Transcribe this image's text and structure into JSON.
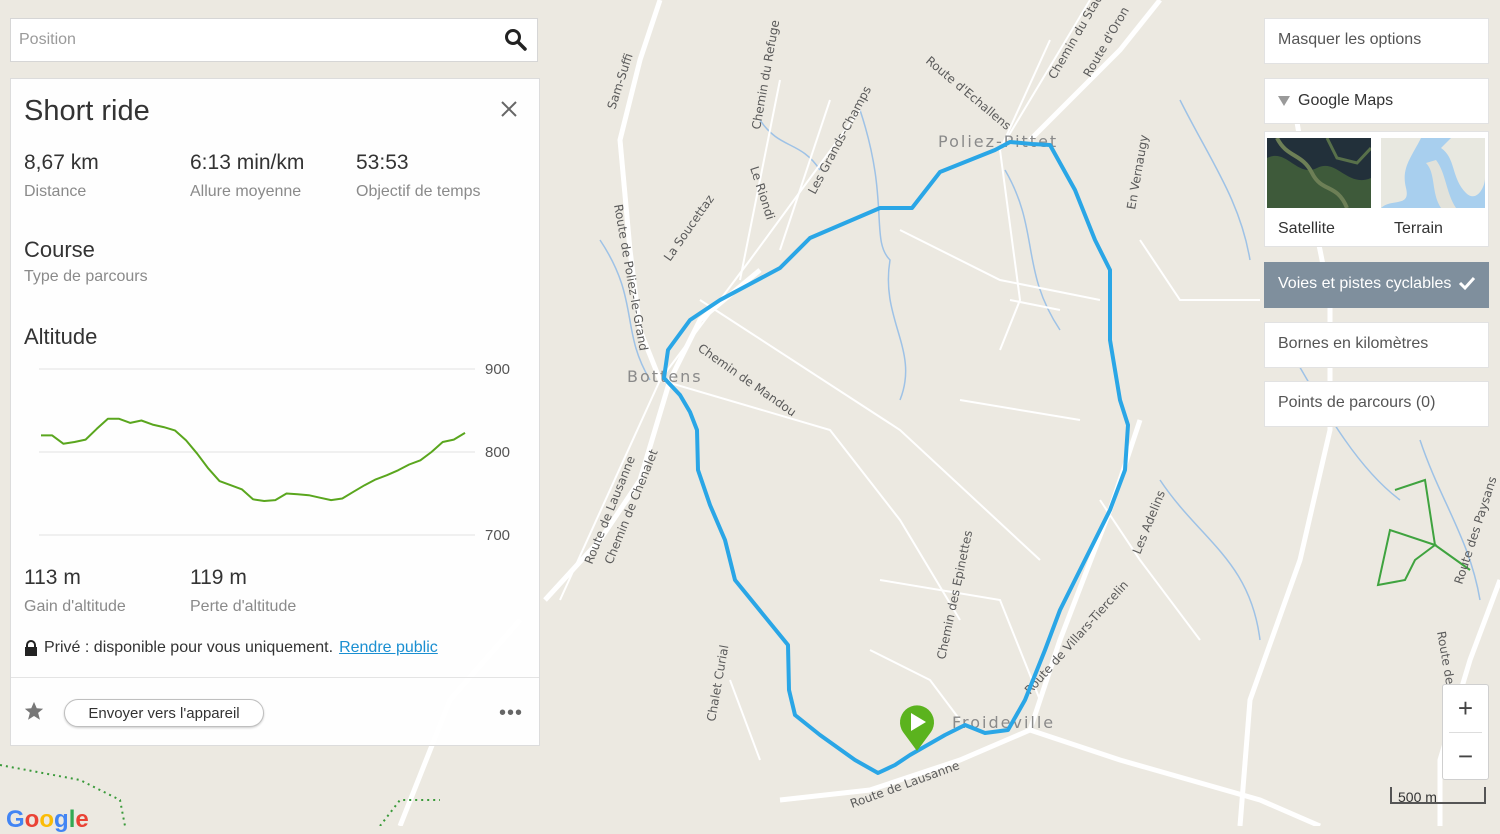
{
  "search": {
    "placeholder": "Position"
  },
  "panel": {
    "title": "Short ride",
    "stats": [
      {
        "value": "8,67 km",
        "label": "Distance"
      },
      {
        "value": "6:13 min/km",
        "label": "Allure moyenne"
      },
      {
        "value": "53:53",
        "label": "Objectif de temps"
      }
    ],
    "route_type": {
      "value": "Course",
      "label": "Type de parcours"
    },
    "altitude_title": "Altitude",
    "elevation": [
      {
        "value": "113 m",
        "label": "Gain d'altitude"
      },
      {
        "value": "119 m",
        "label": "Perte d'altitude"
      }
    ],
    "privacy_text": "Privé : disponible pour vous uniquement.",
    "privacy_link": "Rendre public",
    "send_button": "Envoyer vers l'appareil",
    "more_label": "•••"
  },
  "chart_data": {
    "type": "line",
    "ylabel": "",
    "ylim": [
      700,
      900
    ],
    "yticks": [
      900,
      800,
      700
    ],
    "series": [
      {
        "values": [
          820,
          820,
          810,
          812,
          815,
          828,
          840,
          840,
          835,
          838,
          833,
          830,
          826,
          814,
          798,
          780,
          765,
          760,
          755,
          743,
          741,
          742,
          750,
          749,
          748,
          745,
          742,
          744,
          752,
          760,
          767,
          772,
          778,
          785,
          790,
          800,
          812,
          815,
          823
        ]
      }
    ],
    "color": "#5aa61e"
  },
  "options": {
    "hide_label": "Masquer les options",
    "google_maps_label": "Google Maps",
    "map_types": [
      "Satellite",
      "Terrain"
    ],
    "bike_lanes_label": "Voies et pistes cyclables",
    "km_markers_label": "Bornes en kilomètres",
    "route_points_label": "Points de parcours (0)"
  },
  "map": {
    "towns": [
      "Poliez-Pittet",
      "Bottens",
      "Froideville"
    ],
    "streets": [
      "Route de Lausanne",
      "Route de Poliez-le-Grand",
      "Chemin de Mandou",
      "Les Grands-Champs",
      "Chemin du Refuge",
      "Le Riondi",
      "La Soucettaz",
      "Route d'Echallens",
      "Chemin des Epinettes",
      "Route de Villars-Tiercelin",
      "Les Adelins",
      "En Vernaugy",
      "Chemin de Chenalet",
      "Chalet Curial",
      "Route d'Oron",
      "Sam-Suffi",
      "Route des Paysans"
    ],
    "zoom_in": "+",
    "zoom_out": "−",
    "scale_label": "500 m",
    "route_color": "#2aa6e6",
    "start_marker_color": "#5bb31e"
  },
  "google_logo": "Google"
}
